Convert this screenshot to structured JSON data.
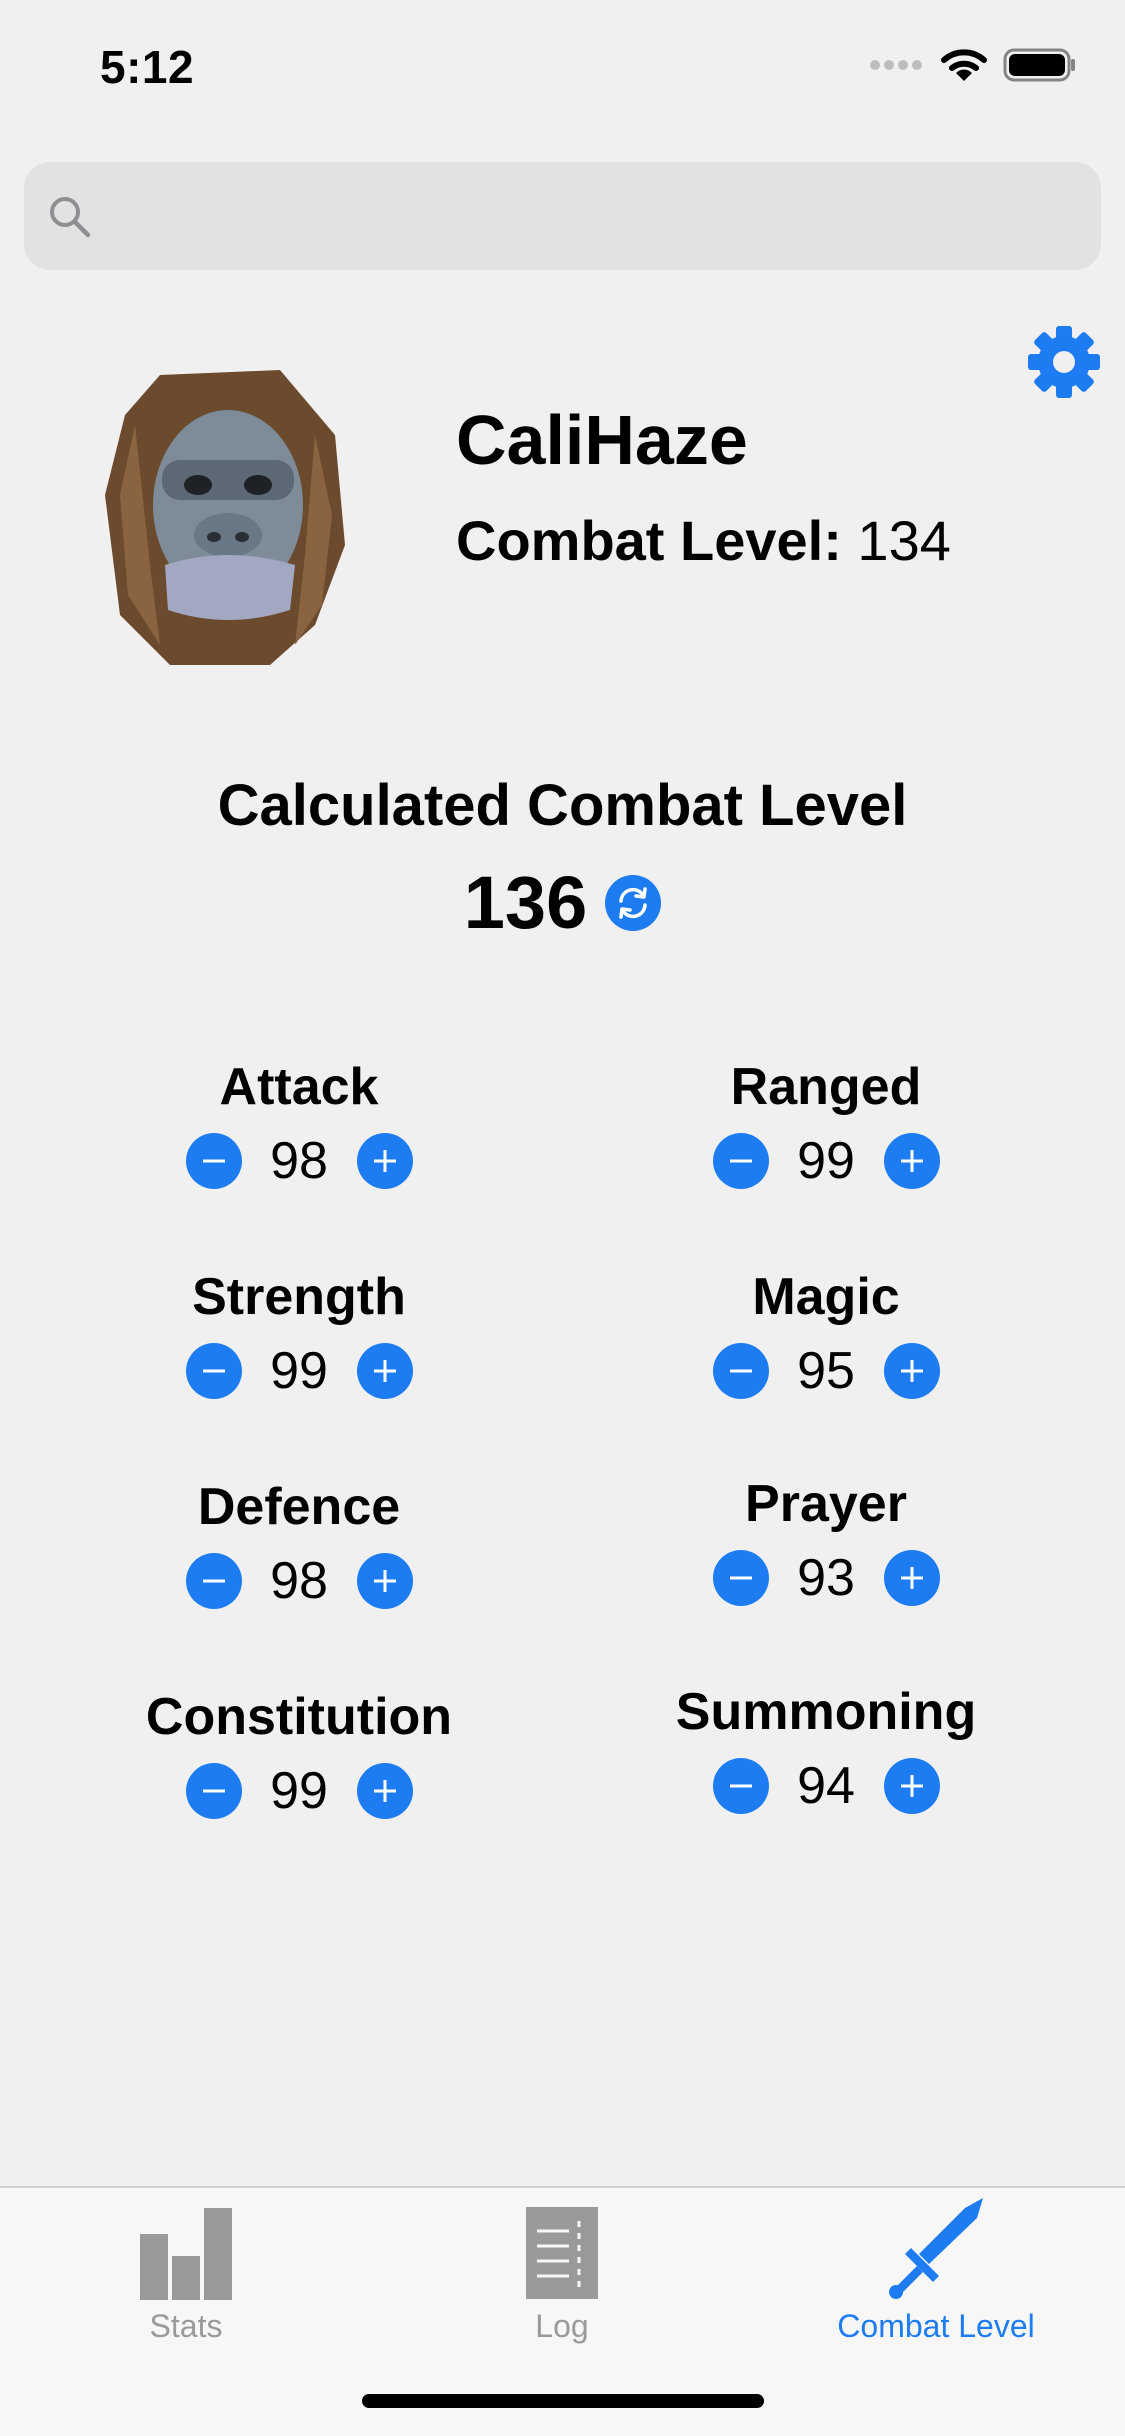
{
  "status_bar": {
    "time": "5:12"
  },
  "search": {
    "placeholder": ""
  },
  "profile": {
    "name": "CaliHaze",
    "combat_level_label": "Combat Level:",
    "combat_level_value": "134"
  },
  "calculated": {
    "title": "Calculated Combat Level",
    "value": "136"
  },
  "stats": {
    "left": [
      {
        "name": "Attack",
        "value": "98"
      },
      {
        "name": "Strength",
        "value": "99"
      },
      {
        "name": "Defence",
        "value": "98"
      },
      {
        "name": "Constitution",
        "value": "99"
      }
    ],
    "right": [
      {
        "name": "Ranged",
        "value": "99"
      },
      {
        "name": "Magic",
        "value": "95"
      },
      {
        "name": "Prayer",
        "value": "93"
      },
      {
        "name": "Summoning",
        "value": "94"
      }
    ]
  },
  "tabs": [
    {
      "label": "Stats",
      "icon": "bar-chart-icon",
      "active": false
    },
    {
      "label": "Log",
      "icon": "log-list-icon",
      "active": false
    },
    {
      "label": "Combat Level",
      "icon": "sword-icon",
      "active": true
    }
  ],
  "colors": {
    "accent": "#1d7cf2",
    "inactive_tab": "#9a9a9a",
    "background": "#f0f0f0"
  }
}
